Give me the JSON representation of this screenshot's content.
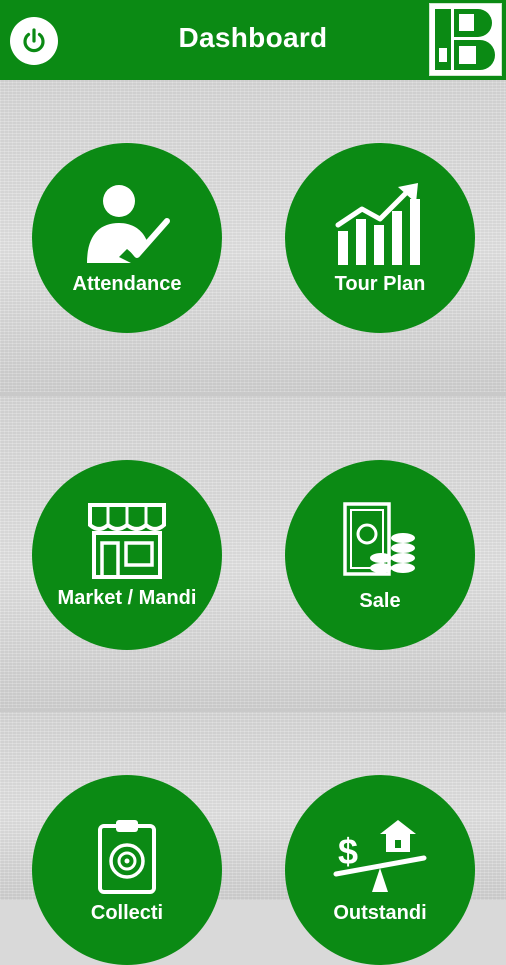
{
  "header": {
    "title": "Dashboard",
    "power_icon": "power-icon",
    "logo_icon": "brand-logo"
  },
  "tiles": [
    {
      "label": "Attendance",
      "icon": "user-check-icon"
    },
    {
      "label": "Tour Plan",
      "icon": "growth-chart-icon"
    },
    {
      "label": "Market / Mandi",
      "icon": "shop-icon"
    },
    {
      "label": "Sale",
      "icon": "cash-coins-icon"
    },
    {
      "label": "Collecti",
      "icon": "target-clipboard-icon"
    },
    {
      "label": "Outstandi",
      "icon": "debt-scale-icon"
    }
  ],
  "colors": {
    "primary": "#0b8a14",
    "text": "#ffffff",
    "background": "#d9d9d9"
  }
}
